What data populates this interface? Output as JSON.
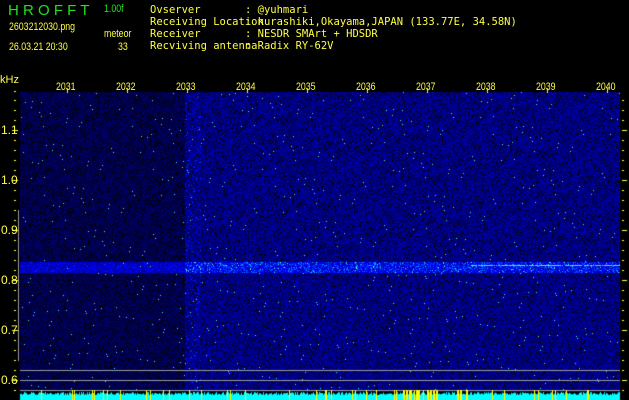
{
  "header": {
    "logo": "H R O F F T",
    "version": "1.00f",
    "filename": "2603212030.png",
    "datetime": "26.03.21 20:30",
    "mode_label": "meteor",
    "count": "33",
    "info": [
      {
        "label": "Ovserver",
        "value": ": @yuhmari"
      },
      {
        "label": "Receiving Location",
        "value": ": kurashiki,Okayama,JAPAN (133.77E, 34.58N)"
      },
      {
        "label": "Receiver",
        "value": ": NESDR SMArt + HDSDR"
      },
      {
        "label": "Recviving antenna",
        "value": ": Radix RY-62V"
      }
    ]
  },
  "axis": {
    "y_unit": "kHz",
    "x_ticks": [
      "2031",
      "2032",
      "2033",
      "2034",
      "2035",
      "2036",
      "2037",
      "2038",
      "2039",
      "2040"
    ],
    "y_ticks": [
      "1.1",
      "1.0",
      "0.9",
      "0.8",
      "0.7",
      "0.6"
    ]
  },
  "colors": {
    "text": "#ffff44",
    "logo": "#22e022",
    "level": "#00ffff",
    "signal": "#33ccff"
  }
}
